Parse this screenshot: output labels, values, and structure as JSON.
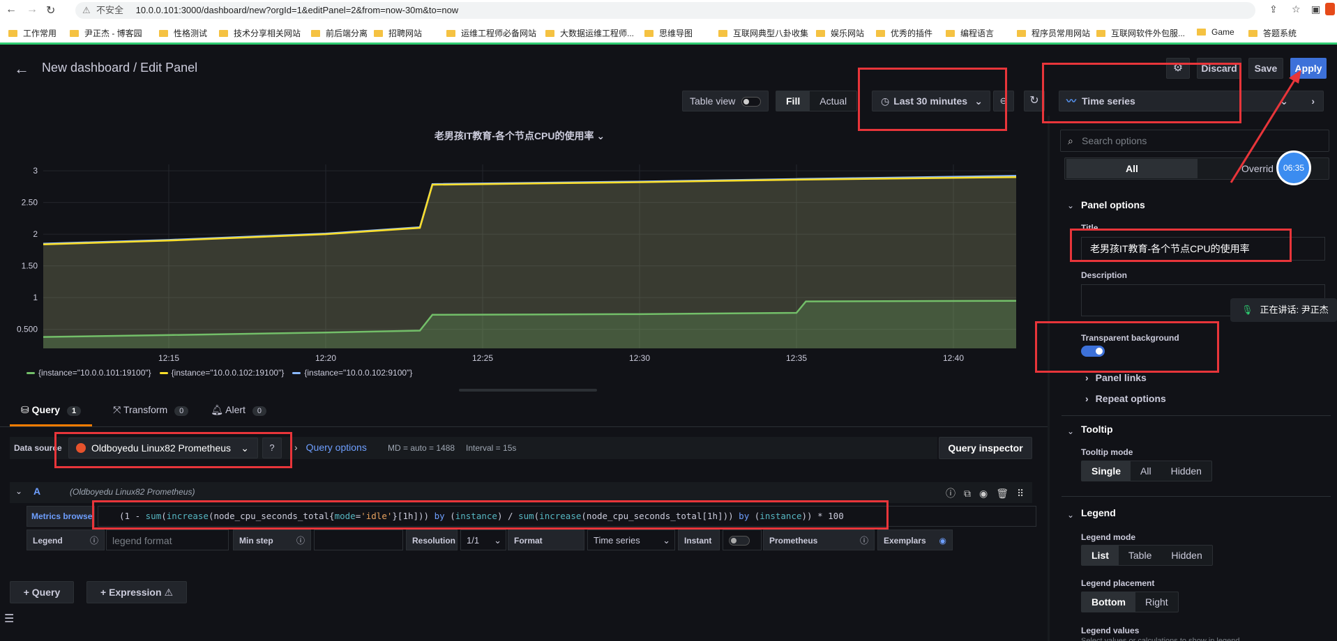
{
  "browser": {
    "security_label": "不安全",
    "url": "10.0.0.101:3000/dashboard/new?orgId=1&editPanel=2&from=now-30m&to=now",
    "bookmarks": [
      "工作常用",
      "尹正杰 - 博客园",
      "性格测试",
      "技术分享相关网站",
      "前后端分离",
      "招聘网站",
      "运维工程师必备网站",
      "大数据运维工程师...",
      "思维导图",
      "互联网典型八卦收集",
      "娱乐网站",
      "优秀的插件",
      "编程语言",
      "程序员常用网站",
      "互联网软件外包服...",
      "Game",
      "答题系统"
    ]
  },
  "header": {
    "title": "New dashboard / Edit Panel",
    "discard": "Discard",
    "save": "Save",
    "apply": "Apply"
  },
  "toolbar": {
    "table_view": "Table view",
    "fill": "Fill",
    "actual": "Actual",
    "time_range": "Last 30 minutes",
    "viz_type": "Time series"
  },
  "panel": {
    "title": "老男孩IT教育-各个节点CPU的使用率"
  },
  "chart_data": {
    "type": "area",
    "title": "老男孩IT教育-各个节点CPU的使用率",
    "xlabel": "",
    "ylabel": "",
    "x_ticks": [
      "12:15",
      "12:20",
      "12:25",
      "12:30",
      "12:35",
      "12:40"
    ],
    "y_ticks": [
      "0.500",
      "1",
      "1.50",
      "2",
      "2.50",
      "3"
    ],
    "ylim": [
      0.2,
      3.1
    ],
    "xlim": [
      "12:11",
      "12:42"
    ],
    "grid": true,
    "legend_placement": "bottom",
    "series": [
      {
        "name": "{instance=\"10.0.0.101:19100\"}",
        "color": "#73bf69",
        "points": [
          [
            "12:11",
            0.38
          ],
          [
            "12:15",
            0.41
          ],
          [
            "12:20",
            0.45
          ],
          [
            "12:23",
            0.48
          ],
          [
            "12:23.4",
            0.73
          ],
          [
            "12:30",
            0.74
          ],
          [
            "12:35",
            0.76
          ],
          [
            "12:35.3",
            0.94
          ],
          [
            "12:42",
            0.95
          ]
        ]
      },
      {
        "name": "{instance=\"10.0.0.102:19100\"}",
        "color": "#fade2a",
        "points": [
          [
            "12:11",
            1.84
          ],
          [
            "12:15",
            1.9
          ],
          [
            "12:20",
            2.0
          ],
          [
            "12:23",
            2.1
          ],
          [
            "12:23.4",
            2.78
          ],
          [
            "12:30",
            2.82
          ],
          [
            "12:35",
            2.86
          ],
          [
            "12:42",
            2.9
          ]
        ]
      },
      {
        "name": "{instance=\"10.0.0.102:9100\"}",
        "color": "#8ab8ff",
        "points": [
          [
            "12:11",
            1.85
          ],
          [
            "12:15",
            1.91
          ],
          [
            "12:20",
            2.01
          ],
          [
            "12:23",
            2.11
          ],
          [
            "12:23.4",
            2.79
          ],
          [
            "12:30",
            2.83
          ],
          [
            "12:35",
            2.87
          ],
          [
            "12:42",
            2.92
          ]
        ]
      }
    ]
  },
  "tabs": {
    "query": "Query",
    "query_count": "1",
    "transform": "Transform",
    "transform_count": "0",
    "alert": "Alert",
    "alert_count": "0"
  },
  "query": {
    "data_source_label": "Data source",
    "data_source": "Oldboyedu Linux82 Prometheus",
    "query_options": "Query options",
    "md": "MD = auto = 1488",
    "interval": "Interval = 15s",
    "query_inspector": "Query inspector",
    "ref_id": "A",
    "ref_source": "(Oldboyedu Linux82 Prometheus)",
    "metrics_browser": "Metrics browser",
    "expr": "(1 - sum(increase(node_cpu_seconds_total{mode='idle'}[1h])) by (instance) / sum(increase(node_cpu_seconds_total[1h])) by (instance)) * 100",
    "legend_label": "Legend",
    "legend_placeholder": "legend format",
    "min_step_label": "Min step",
    "resolution_label": "Resolution",
    "resolution_value": "1/1",
    "format_label": "Format",
    "format_value": "Time series",
    "instant_label": "Instant",
    "prometheus_label": "Prometheus",
    "exemplars_label": "Exemplars",
    "add_query": "Query",
    "add_expression": "Expression"
  },
  "options": {
    "search_placeholder": "Search options",
    "all": "All",
    "overrides": "Overrid",
    "timer": "06:35",
    "panel_options": "Panel options",
    "title_label": "Title",
    "title_value": "老男孩IT教育-各个节点CPU的使用率",
    "description_label": "Description",
    "speaking": "正在讲话: 尹正杰",
    "transparent_label": "Transparent background",
    "panel_links": "Panel links",
    "repeat_options": "Repeat options",
    "tooltip": "Tooltip",
    "tooltip_mode_label": "Tooltip mode",
    "tooltip_modes": [
      "Single",
      "All",
      "Hidden"
    ],
    "legend": "Legend",
    "legend_mode_label": "Legend mode",
    "legend_modes": [
      "List",
      "Table",
      "Hidden"
    ],
    "legend_placement_label": "Legend placement",
    "legend_placements": [
      "Bottom",
      "Right"
    ],
    "legend_values_label": "Legend values",
    "legend_values_hint": "Select values or calculations to show in legend"
  }
}
